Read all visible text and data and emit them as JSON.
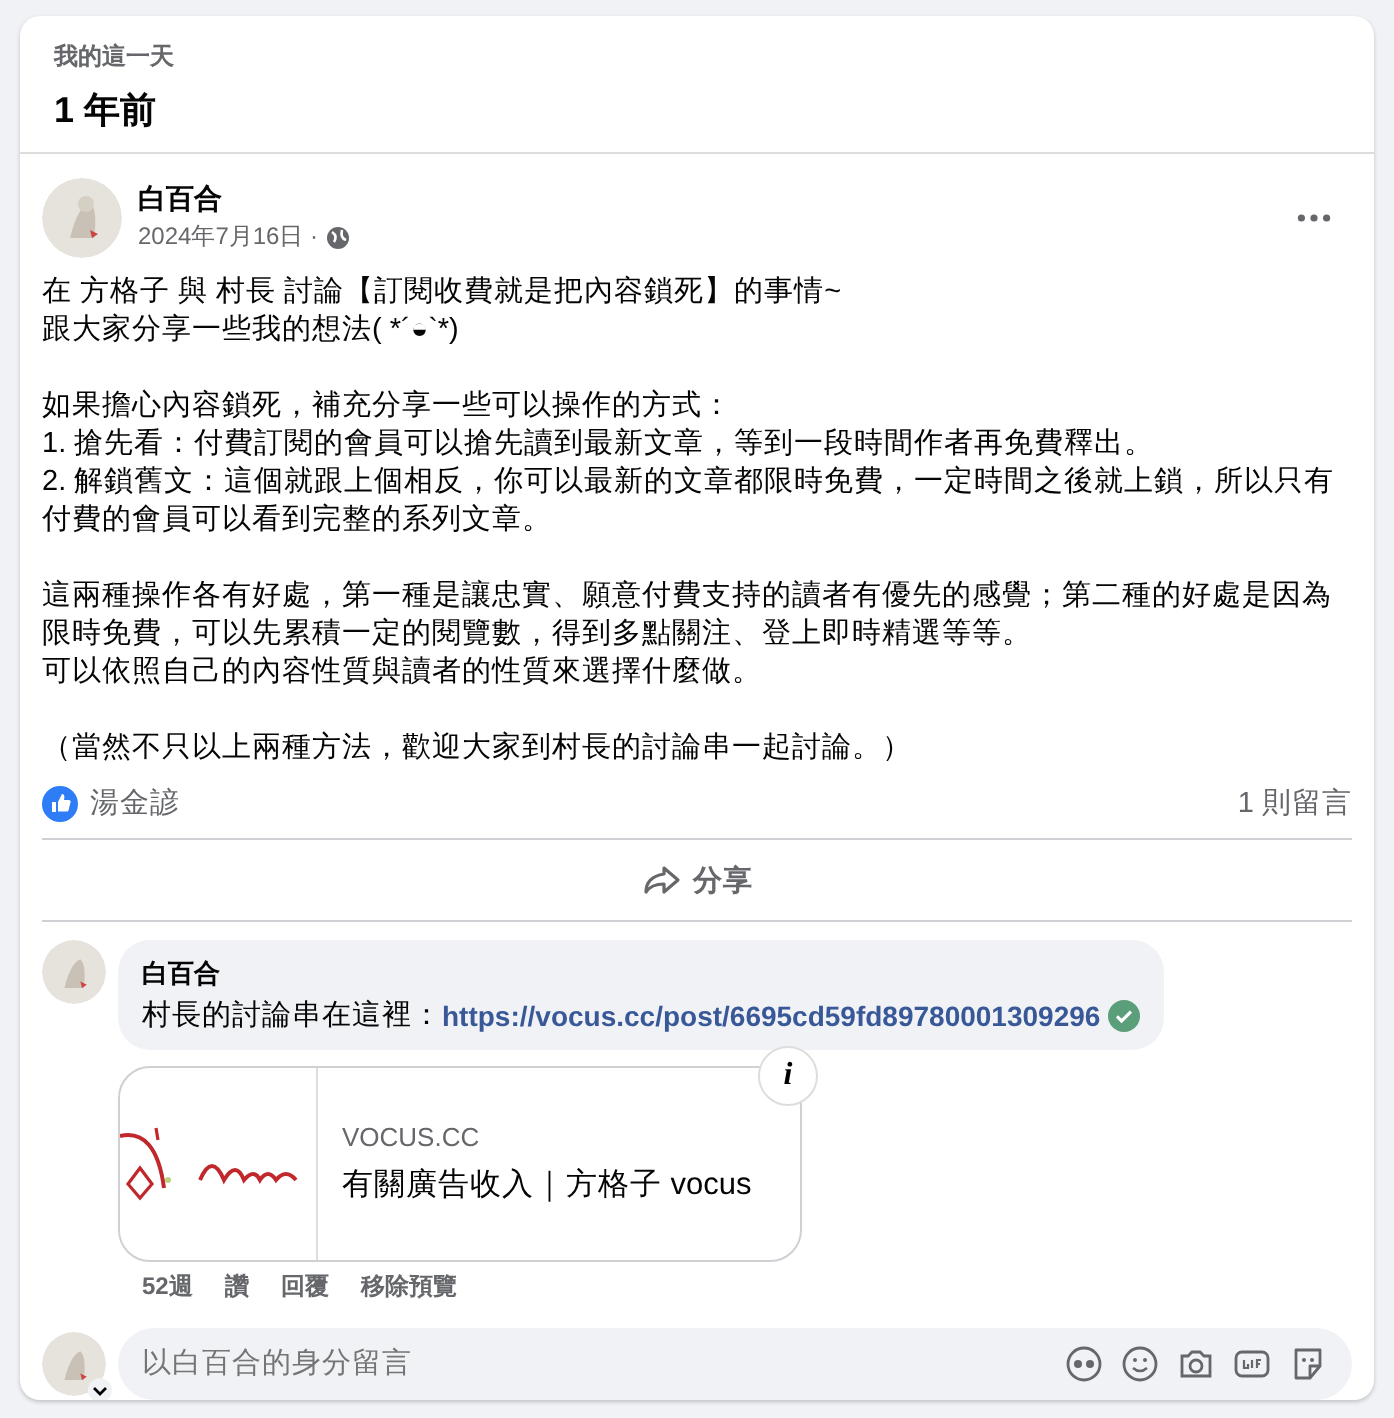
{
  "memory": {
    "label": "我的這一天",
    "title": "1 年前"
  },
  "post": {
    "author": "白百合",
    "date": "2024年7月16日 ·",
    "paragraphs": [
      [
        "在 方格子 與 村長 討論【訂閱收費就是把內容鎖死】的事情~",
        "跟大家分享一些我的想法( *´◒`*)"
      ],
      [
        "如果擔心內容鎖死，補充分享一些可以操作的方式：",
        "1. 搶先看：付費訂閱的會員可以搶先讀到最新文章，等到一段時間作者再免費釋出。",
        "2. 解鎖舊文：這個就跟上個相反，你可以最新的文章都限時免費，一定時間之後就上鎖，所以只有付費的會員可以看到完整的系列文章。"
      ],
      [
        "這兩種操作各有好處，第一種是讓忠實、願意付費支持的讀者有優先的感覺；第二種的好處是因為限時免費，可以先累積一定的閱覽數，得到多點關注、登上即時精選等等。",
        "可以依照自己的內容性質與讀者的性質來選擇什麼做。"
      ],
      [
        "（當然不只以上兩種方法，歡迎大家到村長的討論串一起討論。）"
      ]
    ],
    "liker": "湯金諺",
    "comment_count": "1 則留言",
    "share": "分享"
  },
  "comment": {
    "author": "白百合",
    "text": "村長的討論串在這裡：",
    "link": "https://vocus.cc/post/6695cd59fd89780001309296",
    "preview": {
      "domain": "VOCUS.CC",
      "title": "有關廣告收入｜方格子 vocus",
      "info": "i"
    },
    "actions": [
      "52週",
      "讚",
      "回覆",
      "移除預覽"
    ]
  },
  "composer": {
    "placeholder": "以白百合的身分留言"
  }
}
